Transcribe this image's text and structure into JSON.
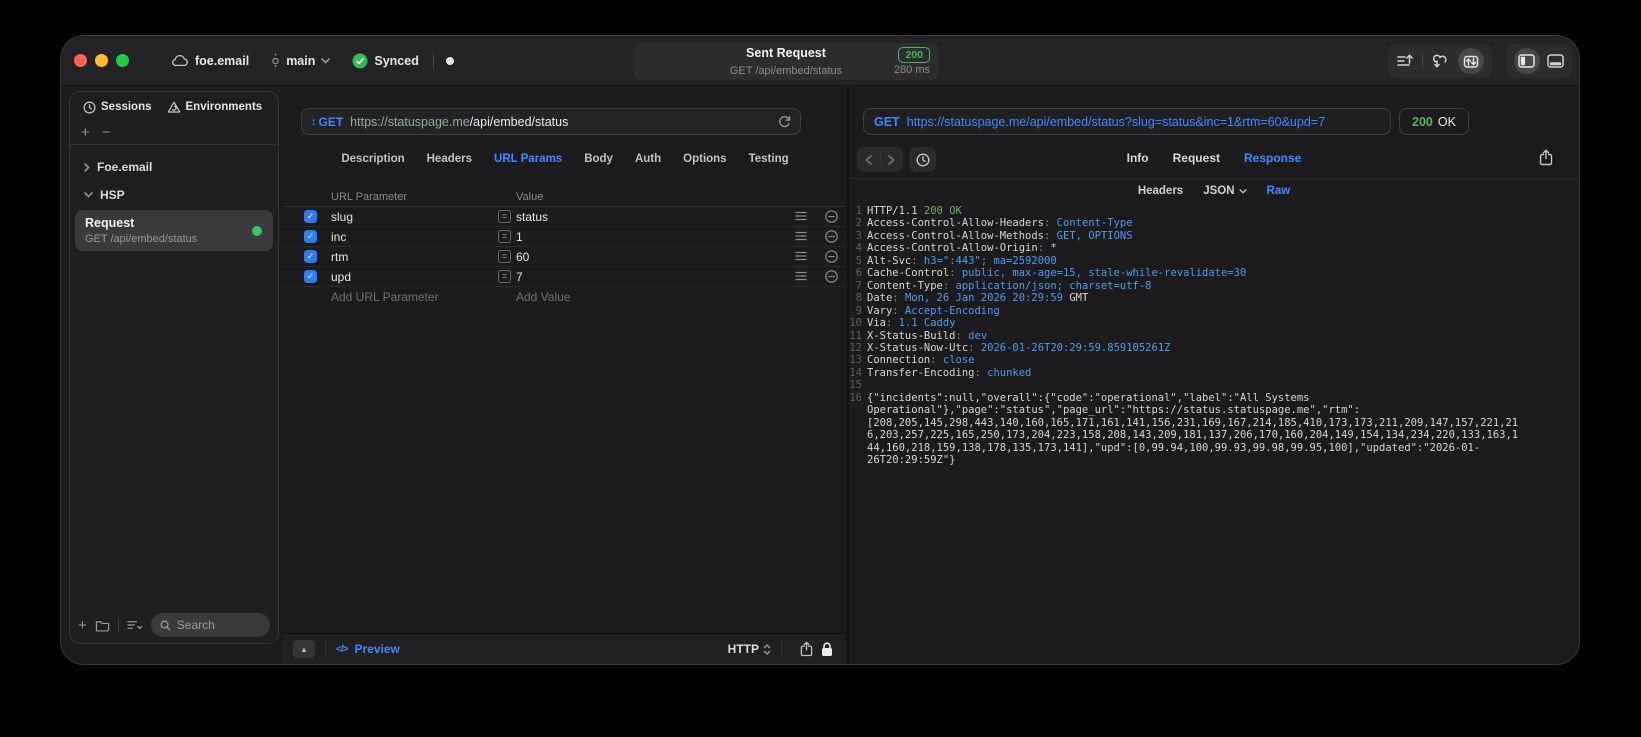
{
  "titlebar": {
    "project_name": "foe.email",
    "branch_name": "main",
    "sync_label": "Synced",
    "request_pill": {
      "title": "Sent Request",
      "subtitle": "GET /api/embed/status",
      "status_code": "200",
      "duration": "280 ms"
    }
  },
  "sidebar": {
    "tabs": [
      {
        "label": "Sessions"
      },
      {
        "label": "Environments"
      }
    ],
    "tree": {
      "collapsed_item": "Foe.email",
      "expanded_item": "HSP",
      "request": {
        "title": "Request",
        "subtitle": "GET /api/embed/status"
      }
    },
    "search_placeholder": "Search"
  },
  "request_panel": {
    "method": "GET",
    "url_host": "https://statuspage.me",
    "url_path": "/api/embed/status",
    "tabs": [
      "Description",
      "Headers",
      "URL Params",
      "Body",
      "Auth",
      "Options",
      "Testing"
    ],
    "active_tab": "URL Params",
    "params_table": {
      "columns": [
        "URL Parameter",
        "Value"
      ],
      "rows": [
        {
          "name": "slug",
          "value": "status",
          "enabled": true
        },
        {
          "name": "inc",
          "value": "1",
          "enabled": true
        },
        {
          "name": "rtm",
          "value": "60",
          "enabled": true
        },
        {
          "name": "upd",
          "value": "7",
          "enabled": true
        }
      ],
      "add_name_placeholder": "Add URL Parameter",
      "add_value_placeholder": "Add Value"
    },
    "footer": {
      "preview_label": "Preview",
      "protocol": "HTTP"
    }
  },
  "response_panel": {
    "method": "GET",
    "url": "https://statuspage.me/api/embed/status?slug=status&inc=1&rtm=60&upd=7",
    "status_code": "200",
    "status_text": "OK",
    "tabs": [
      "Info",
      "Request",
      "Response"
    ],
    "active_tab": "Response",
    "subtabs": [
      "Headers",
      "JSON",
      "Raw"
    ],
    "active_subtab": "Raw",
    "body_lines": [
      {
        "n": "1",
        "segments": [
          {
            "t": "HTTP/1.1 ",
            "c": "plain"
          },
          {
            "t": "200 OK",
            "c": "green"
          }
        ]
      },
      {
        "n": "2",
        "segments": [
          {
            "t": "Access-Control-Allow-Headers",
            "c": "plain"
          },
          {
            "t": ": ",
            "c": "gray"
          },
          {
            "t": "Content-Type",
            "c": "blue"
          }
        ]
      },
      {
        "n": "3",
        "segments": [
          {
            "t": "Access-Control-Allow-Methods",
            "c": "plain"
          },
          {
            "t": ": ",
            "c": "gray"
          },
          {
            "t": "GET, OPTIONS",
            "c": "blue"
          }
        ]
      },
      {
        "n": "4",
        "segments": [
          {
            "t": "Access-Control-Allow-Origin",
            "c": "plain"
          },
          {
            "t": ": ",
            "c": "gray"
          },
          {
            "t": "*",
            "c": "plain"
          }
        ]
      },
      {
        "n": "5",
        "segments": [
          {
            "t": "Alt-Svc",
            "c": "plain"
          },
          {
            "t": ": ",
            "c": "gray"
          },
          {
            "t": "h3=\":443\"; ma=2592000",
            "c": "blue"
          }
        ]
      },
      {
        "n": "6",
        "segments": [
          {
            "t": "Cache-Control",
            "c": "plain"
          },
          {
            "t": ": ",
            "c": "gray"
          },
          {
            "t": "public, max-age=15, stale-while-revalidate=30",
            "c": "blue"
          }
        ]
      },
      {
        "n": "7",
        "segments": [
          {
            "t": "Content-Type",
            "c": "plain"
          },
          {
            "t": ": ",
            "c": "gray"
          },
          {
            "t": "application/json; charset=utf-8",
            "c": "blue"
          }
        ]
      },
      {
        "n": "8",
        "segments": [
          {
            "t": "Date",
            "c": "plain"
          },
          {
            "t": ": ",
            "c": "gray"
          },
          {
            "t": "Mon, 26 Jan 2026 20:29:59",
            "c": "blue"
          },
          {
            "t": " GMT",
            "c": "plain"
          }
        ]
      },
      {
        "n": "9",
        "segments": [
          {
            "t": "Vary",
            "c": "plain"
          },
          {
            "t": ": ",
            "c": "gray"
          },
          {
            "t": "Accept-Encoding",
            "c": "blue"
          }
        ]
      },
      {
        "n": "10",
        "segments": [
          {
            "t": "Via",
            "c": "plain"
          },
          {
            "t": ": ",
            "c": "gray"
          },
          {
            "t": "1.1 Caddy",
            "c": "blue"
          }
        ]
      },
      {
        "n": "11",
        "segments": [
          {
            "t": "X-Status-Build",
            "c": "plain"
          },
          {
            "t": ": ",
            "c": "gray"
          },
          {
            "t": "dev",
            "c": "blue"
          }
        ]
      },
      {
        "n": "12",
        "segments": [
          {
            "t": "X-Status-Now-Utc",
            "c": "plain"
          },
          {
            "t": ": ",
            "c": "gray"
          },
          {
            "t": "2026-01-26T20:29:59.859105261Z",
            "c": "blue"
          }
        ]
      },
      {
        "n": "13",
        "segments": [
          {
            "t": "Connection",
            "c": "plain"
          },
          {
            "t": ": ",
            "c": "gray"
          },
          {
            "t": "close",
            "c": "blue"
          }
        ]
      },
      {
        "n": "14",
        "segments": [
          {
            "t": "Transfer-Encoding",
            "c": "plain"
          },
          {
            "t": ": ",
            "c": "gray"
          },
          {
            "t": "chunked",
            "c": "blue"
          }
        ]
      },
      {
        "n": "15",
        "segments": []
      },
      {
        "n": "16",
        "wrap": true,
        "segments": [
          {
            "t": "{\"incidents\":null,\"overall\":{\"code\":\"operational\",\"label\":\"All Systems Operational\"},\"page\":\"status\",\"page_url\":\"https://status.statuspage.me\",\"rtm\":[208,205,145,298,443,140,160,165,171,161,141,156,231,169,167,214,185,410,173,173,211,209,147,157,221,216,203,257,225,165,250,173,204,223,158,208,143,209,181,137,206,170,160,204,149,154,134,234,220,133,163,144,160,218,159,138,178,135,173,141],\"upd\":[0,99.94,100,99.93,99.98,99.95,100],\"updated\":\"2026-01-26T20:29:59Z\"}",
            "c": "plain"
          }
        ]
      }
    ]
  },
  "glyphs": {
    "method_arrows": "↕",
    "expand_triangle": "▲",
    "code": "</>",
    "plus": "+",
    "minus": "−",
    "equals": "=",
    "check": "✓"
  },
  "colors": {
    "accent_blue": "#3e8bff",
    "status_green": "#3fb950",
    "checkbox_blue": "#2e7bf6",
    "value_blue": "#4d9df2",
    "ok_green": "#63b566"
  }
}
